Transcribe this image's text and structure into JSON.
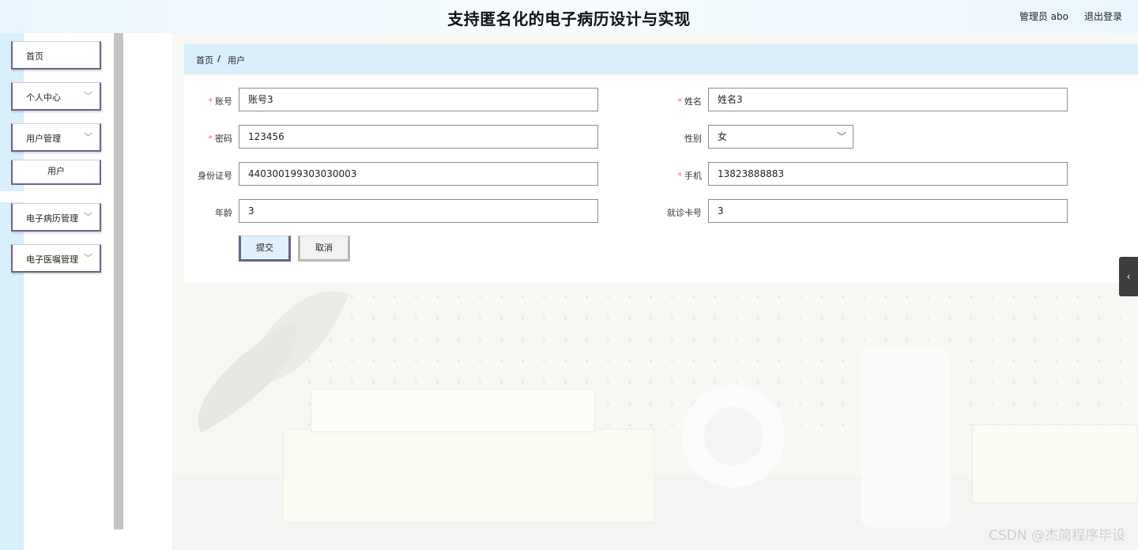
{
  "header": {
    "title": "支持匿名化的电子病历设计与实现",
    "user": "管理员 abo",
    "logout": "退出登录"
  },
  "sidebar": {
    "items": [
      {
        "label": "首页",
        "chevron": false
      },
      {
        "label": "个人中心",
        "chevron": true
      },
      {
        "label": "用户管理",
        "chevron": true
      },
      {
        "label": "用户",
        "chevron": false,
        "sub": true
      },
      {
        "label": "电子病历管理",
        "chevron": true
      },
      {
        "label": "电子医嘱管理",
        "chevron": true
      }
    ],
    "chevron_icon": "chevron-down-icon"
  },
  "breadcrumb": {
    "home": "首页",
    "separator": "/",
    "current": "用户"
  },
  "form": {
    "account_label": "账号",
    "account_value": "账号3",
    "name_label": "姓名",
    "name_value": "姓名3",
    "password_label": "密码",
    "password_value": "123456",
    "gender_label": "性别",
    "gender_value": "女",
    "idcard_label": "身份证号",
    "idcard_value": "440300199303030003",
    "phone_label": "手机",
    "phone_value": "13823888883",
    "age_label": "年龄",
    "age_value": "3",
    "card_label": "就诊卡号",
    "card_value": "3",
    "required_mark": "*",
    "submit": "提交",
    "cancel": "取消"
  },
  "side_tab": {
    "icon": "chevron-left-icon",
    "glyph": "‹"
  },
  "watermark": "CSDN @杰简程序毕设",
  "colors": {
    "accent_border": "#6b6387",
    "breadcrumb_bg": "#d9f0fb",
    "sidebar_stripe": "#d8effc",
    "required": "#f56c6c"
  }
}
